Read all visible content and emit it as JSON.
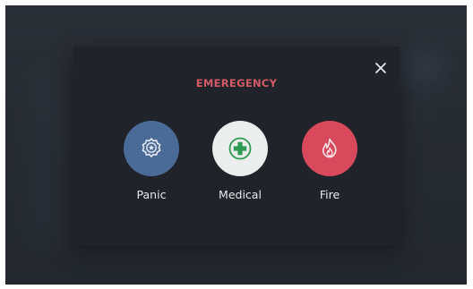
{
  "modal": {
    "title": "EMEREGENCY",
    "close_icon": "close-icon",
    "options": [
      {
        "label": "Panic",
        "icon": "police-badge-icon",
        "color": "#4a6a98"
      },
      {
        "label": "Medical",
        "icon": "medical-cross-icon",
        "color": "#eceeed"
      },
      {
        "label": "Fire",
        "icon": "flame-icon",
        "color": "#d9495c"
      }
    ]
  },
  "colors": {
    "accent_title": "#d45a66",
    "modal_background": "#202329",
    "page_background": "#262a31",
    "medical_cross": "#2e9a52"
  }
}
